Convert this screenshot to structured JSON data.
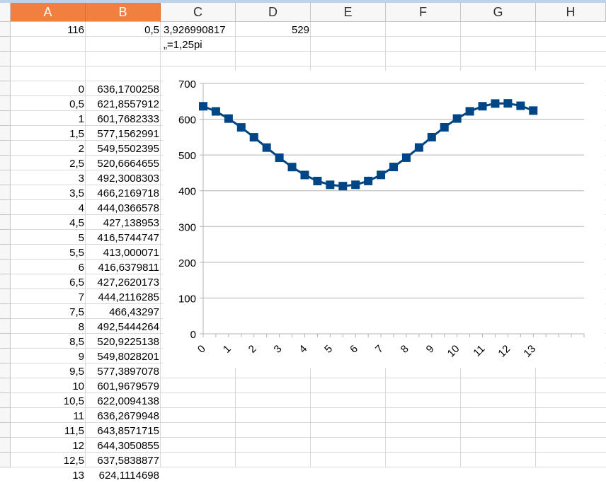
{
  "columns": [
    "A",
    "B",
    "C",
    "D",
    "E",
    "F",
    "G",
    "H"
  ],
  "selected_columns": [
    "A",
    "B"
  ],
  "row1": {
    "A": "116",
    "B": "0,5",
    "C": "3,926990817",
    "D": "529"
  },
  "row2": {
    "C": "„=1,25pi"
  },
  "table": {
    "a": [
      "0",
      "0,5",
      "1",
      "1,5",
      "2",
      "2,5",
      "3",
      "3,5",
      "4",
      "4,5",
      "5",
      "5,5",
      "6",
      "6,5",
      "7",
      "7,5",
      "8",
      "8,5",
      "9",
      "9,5",
      "10",
      "10,5",
      "11",
      "11,5",
      "12",
      "12,5",
      "13"
    ],
    "b": [
      "636,1700258",
      "621,8557912",
      "601,7682333",
      "577,1562991",
      "549,5502395",
      "520,6664655",
      "492,3008303",
      "466,2169718",
      "444,0366578",
      "427,138953",
      "416,5744747",
      "413,000071",
      "416,6379811",
      "427,2620173",
      "444,2116285",
      "466,43297",
      "492,5444264",
      "520,9225138",
      "549,8028201",
      "577,3897078",
      "601,9679579",
      "622,0094138",
      "636,2679948",
      "643,8571715",
      "644,3050855",
      "637,5838877",
      "624,1114698"
    ]
  },
  "chart_data": {
    "type": "line",
    "x": [
      0,
      0.5,
      1,
      1.5,
      2,
      2.5,
      3,
      3.5,
      4,
      4.5,
      5,
      5.5,
      6,
      6.5,
      7,
      7.5,
      8,
      8.5,
      9,
      9.5,
      10,
      10.5,
      11,
      11.5,
      12,
      12.5,
      13
    ],
    "series": [
      {
        "values": [
          636.1700258,
          621.8557912,
          601.7682333,
          577.1562991,
          549.5502395,
          520.6664655,
          492.3008303,
          466.2169718,
          444.0366578,
          427.138953,
          416.5744747,
          413.000071,
          416.6379811,
          427.2620173,
          444.2116285,
          466.43297,
          492.5444264,
          520.9225138,
          549.8028201,
          577.3897078,
          601.9679579,
          622.0094138,
          636.2679948,
          643.8571715,
          644.3050855,
          637.5838877,
          624.1114698
        ]
      }
    ],
    "ylim": [
      0,
      700
    ],
    "yticks": [
      "0",
      "100",
      "200",
      "300",
      "400",
      "500",
      "600",
      "700"
    ],
    "xticks": [
      "0",
      "1",
      "2",
      "3",
      "4",
      "5",
      "6",
      "7",
      "8",
      "9",
      "10",
      "11",
      "12",
      "13"
    ],
    "grid": true,
    "marker": "square",
    "color": "#004586"
  }
}
